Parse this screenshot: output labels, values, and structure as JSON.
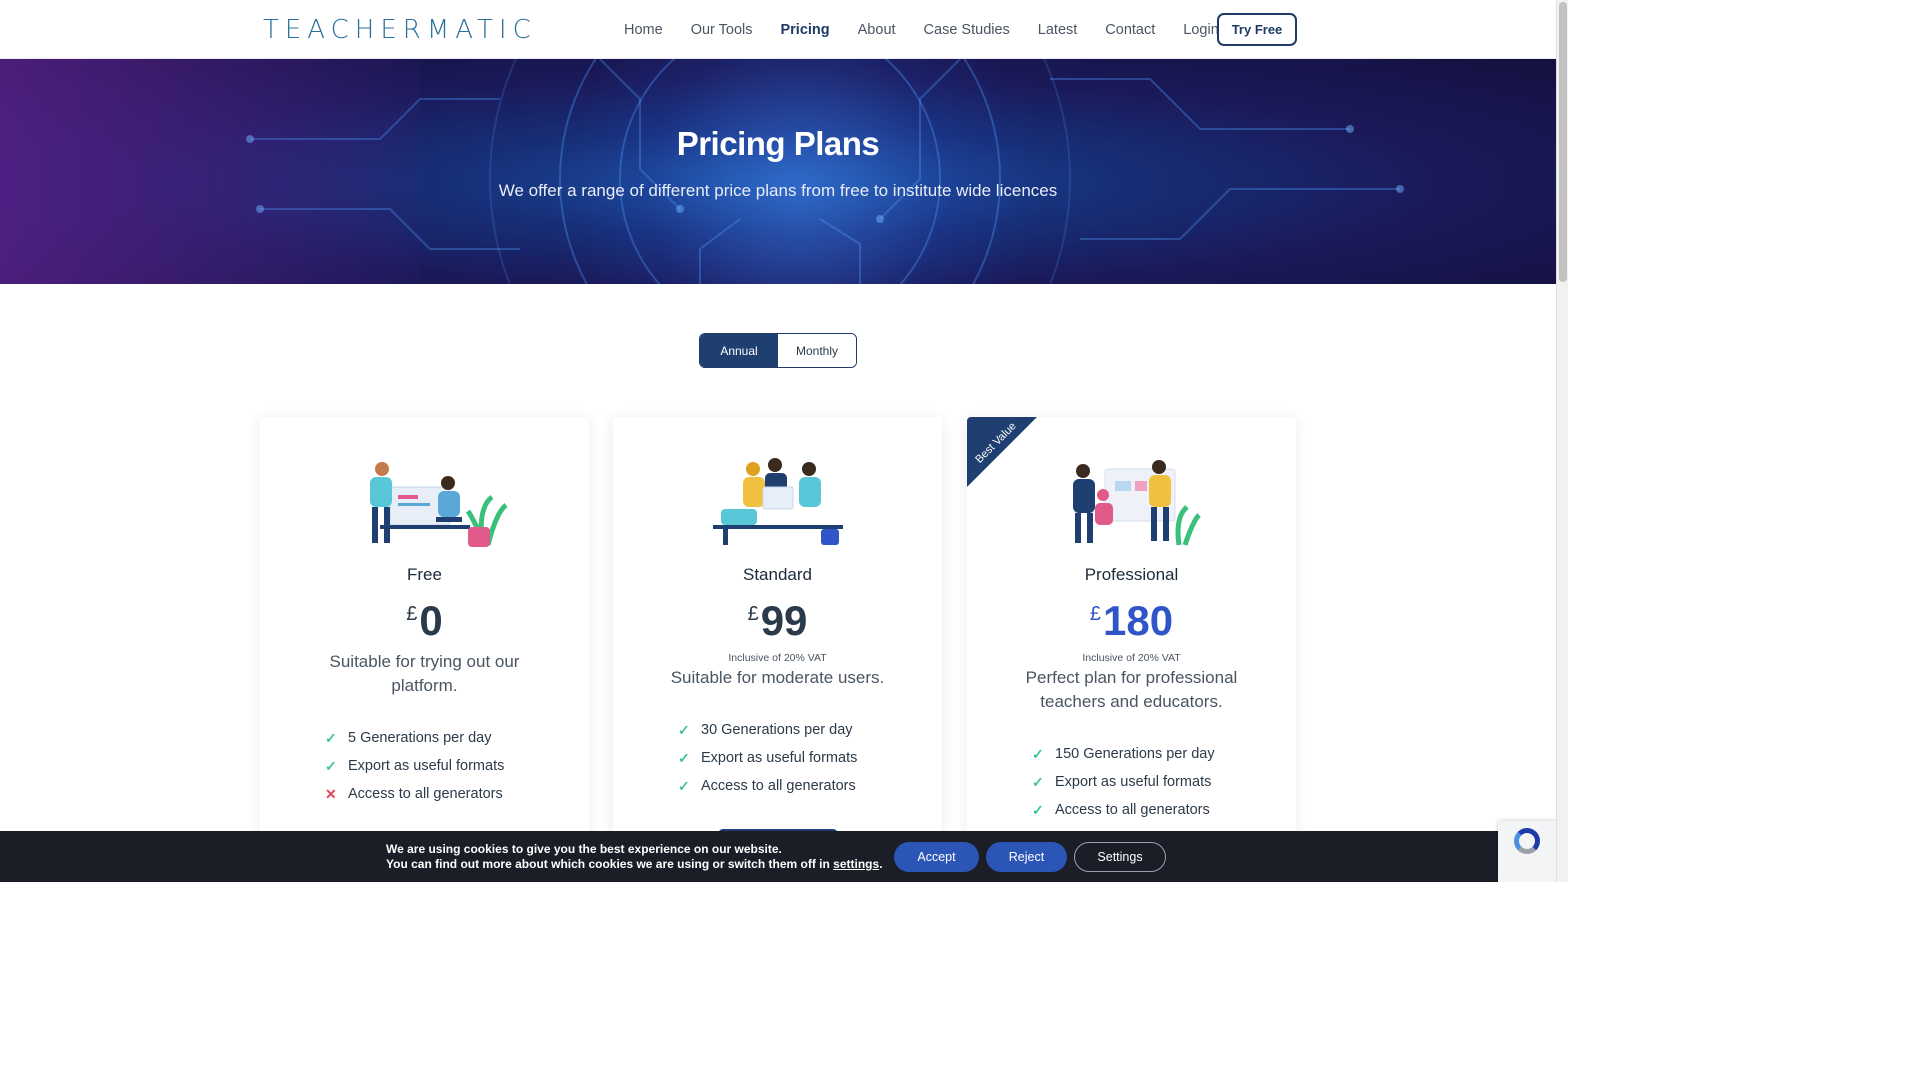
{
  "header": {
    "logo": "TEACHERMATIC",
    "nav": [
      "Home",
      "Our Tools",
      "Pricing",
      "About",
      "Case Studies",
      "Latest",
      "Contact",
      "Login"
    ],
    "active_nav": "Pricing",
    "cta": "Try Free"
  },
  "hero": {
    "title": "Pricing Plans",
    "subtitle": "We offer a range of different price plans from free to institute wide licences"
  },
  "billing_toggle": {
    "annual": "Annual",
    "monthly": "Monthly",
    "selected": "Annual"
  },
  "plans": [
    {
      "name": "Free",
      "currency": "£",
      "price": "0",
      "vat": "",
      "description": "Suitable for trying out our platform.",
      "features": [
        {
          "text": "5 Generations per day",
          "included": true
        },
        {
          "text": "Export as useful formats",
          "included": true
        },
        {
          "text": "Access to all generators",
          "included": false
        }
      ]
    },
    {
      "name": "Standard",
      "currency": "£",
      "price": "99",
      "vat": "Inclusive of 20% VAT",
      "description": "Suitable for moderate users.",
      "features": [
        {
          "text": "30 Generations per day",
          "included": true
        },
        {
          "text": "Export as useful formats",
          "included": true
        },
        {
          "text": "Access to all generators",
          "included": true
        }
      ]
    },
    {
      "name": "Professional",
      "currency": "£",
      "price": "180",
      "vat": "Inclusive of 20% VAT",
      "description": "Perfect plan for professional teachers and educators.",
      "badge": "Best Value",
      "features": [
        {
          "text": "150 Generations per day",
          "included": true
        },
        {
          "text": "Export as useful formats",
          "included": true
        },
        {
          "text": "Access to all generators",
          "included": true
        }
      ]
    }
  ],
  "icons": {
    "check": "check-icon",
    "cross": "cross-icon"
  },
  "cookie_bar": {
    "line1": "We are using cookies to give you the best experience on our website.",
    "line2_prefix": "You can find out more about which cookies we are using or switch them off in ",
    "line2_link": "settings",
    "line2_suffix": ".",
    "accept": "Accept",
    "reject": "Reject",
    "settings": "Settings"
  },
  "colors": {
    "navy": "#1f3f70",
    "accent_blue": "#2f55c8",
    "check_green": "#3fc58a",
    "cross_red": "#e2445c"
  }
}
